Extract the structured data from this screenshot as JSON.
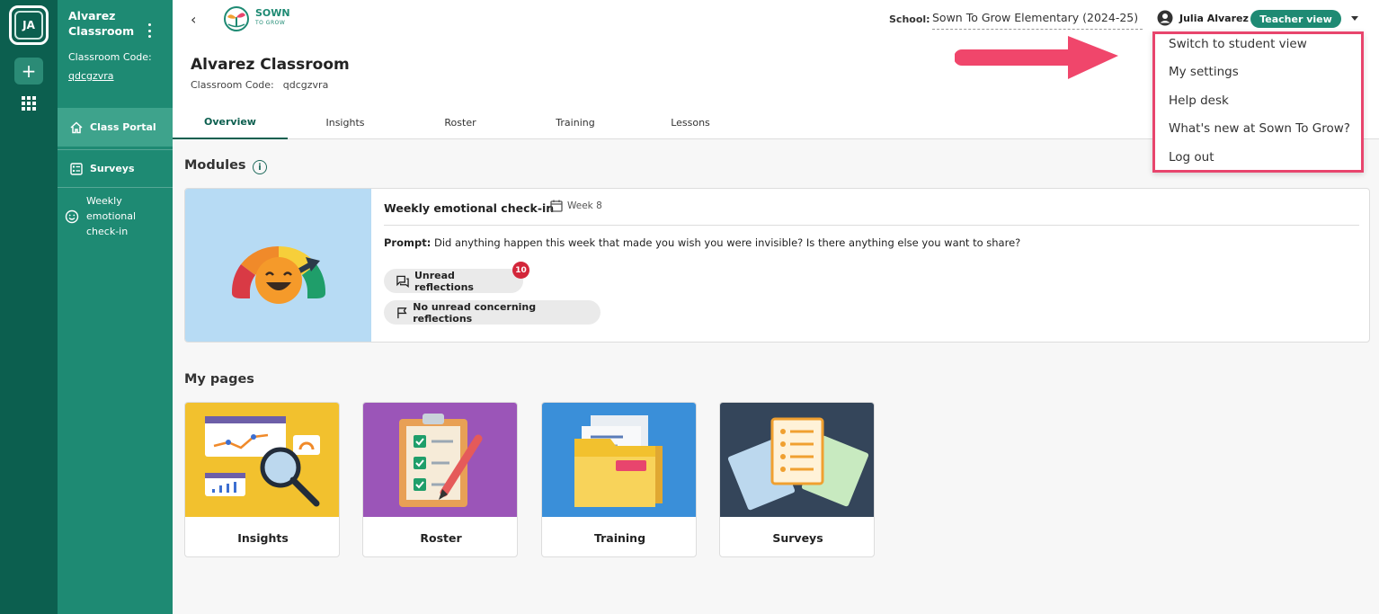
{
  "rail": {
    "avatar_initials": "JA",
    "add_label": "+"
  },
  "sidebar": {
    "class_name": "Alvarez Classroom",
    "code_label": "Classroom Code:",
    "code_value": "qdcgzvra",
    "items": [
      {
        "label": "Class Portal",
        "icon": "home-icon"
      },
      {
        "label": "Surveys",
        "icon": "survey-icon"
      },
      {
        "label": "Weekly emotional check-in",
        "icon": "smiley-icon"
      }
    ]
  },
  "topbar": {
    "logo_text": "SOWN",
    "logo_subtext": "TO GROW",
    "school_label": "School:",
    "school_value": "Sown To Grow Elementary (2024-25)",
    "user_name": "Julia Alvarez",
    "view_badge": "Teacher view"
  },
  "header": {
    "title": "Alvarez Classroom",
    "code_label": "Classroom Code:",
    "code_value": "qdcgzvra",
    "tabs": [
      "Overview",
      "Insights",
      "Roster",
      "Training",
      "Lessons"
    ]
  },
  "modules": {
    "title": "Modules",
    "card": {
      "title": "Weekly emotional check-in",
      "week": "Week 8",
      "prompt_label": "Prompt:",
      "prompt_text": "Did anything happen this week that made you wish you were invisible? Is there anything else you want to share?",
      "unread_label": "Unread reflections",
      "unread_count": "10",
      "concern_label": "No unread concerning reflections"
    }
  },
  "my_pages": {
    "title": "My pages",
    "cards": [
      "Insights",
      "Roster",
      "Training",
      "Surveys"
    ]
  },
  "menu": {
    "items": [
      "Switch to student view",
      "My settings",
      "Help desk",
      "What's new at Sown To Grow?",
      "Log out"
    ]
  },
  "colors": {
    "rail": "#0c5f4f",
    "sidebar": "#1e8a73",
    "accent": "#1e8a73",
    "highlight": "#e8456d",
    "badge_red": "#d3263a"
  }
}
